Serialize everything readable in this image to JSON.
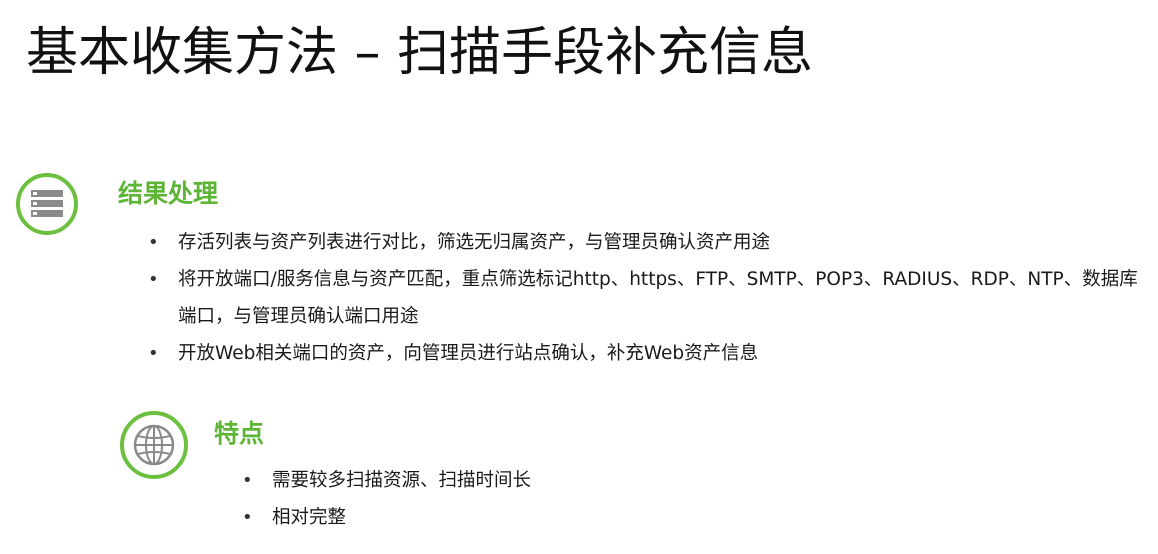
{
  "title": "基本收集方法 – 扫描手段补充信息",
  "colors": {
    "accent": "#5db536",
    "icon_ring": "#6cbf3f",
    "icon_fill": "#8a8a8a"
  },
  "sections": [
    {
      "icon": "server-icon",
      "heading": "结果处理",
      "items": [
        "存活列表与资产列表进行对比，筛选无归属资产，与管理员确认资产用途",
        "将开放端口/服务信息与资产匹配，重点筛选标记http、https、FTP、SMTP、POP3、RADIUS、RDP、NTP、数据库端口，与管理员确认端口用途",
        "开放Web相关端口的资产，向管理员进行站点确认，补充Web资产信息"
      ]
    },
    {
      "icon": "globe-icon",
      "heading": "特点",
      "items": [
        "需要较多扫描资源、扫描时间长",
        "相对完整"
      ]
    }
  ]
}
